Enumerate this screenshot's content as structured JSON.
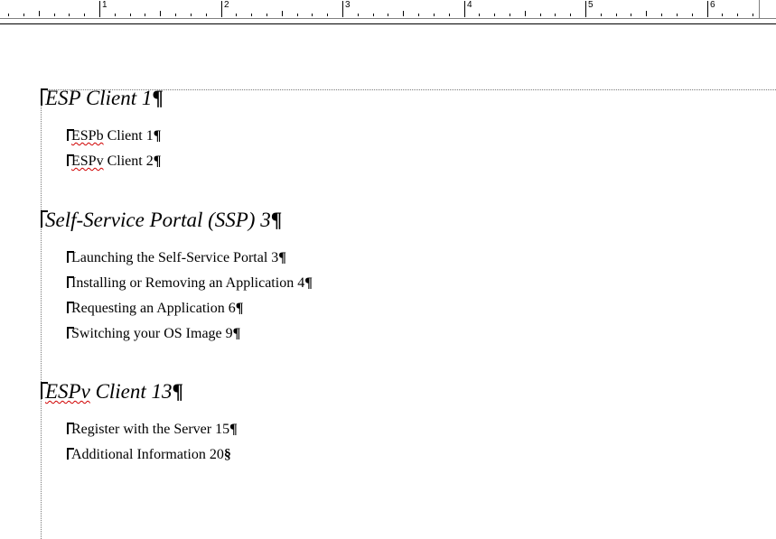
{
  "ruler": {
    "numbers": [
      "1",
      "2",
      "3",
      "4",
      "5",
      "6"
    ]
  },
  "toc": {
    "sections": [
      {
        "title_prefix": "ESP",
        "title_rest": " Client 1",
        "title_mark": "¶",
        "entries": [
          {
            "prefix": "ESPb",
            "rest": " Client 1",
            "mark": "¶"
          },
          {
            "prefix": "ESPv",
            "rest": " Client 2",
            "mark": "¶"
          }
        ]
      },
      {
        "title_prefix": "",
        "title_rest": "Self-Service Portal (SSP) 3",
        "title_mark": "¶",
        "entries": [
          {
            "prefix": "",
            "rest": "Launching the Self-Service Portal 3",
            "mark": "¶"
          },
          {
            "prefix": "",
            "rest": "Installing or Removing an Application 4",
            "mark": "¶"
          },
          {
            "prefix": "",
            "rest": "Requesting an Application 6",
            "mark": "¶"
          },
          {
            "prefix": "",
            "rest": "Switching your OS Image 9",
            "mark": "¶"
          }
        ]
      },
      {
        "title_prefix": "ESPv",
        "title_rest": " Client 13",
        "title_mark": "¶",
        "entries": [
          {
            "prefix": "",
            "rest": "Register with the Server 15",
            "mark": "¶"
          },
          {
            "prefix": "",
            "rest": "Additional Information 20",
            "mark": "§"
          }
        ]
      }
    ]
  }
}
